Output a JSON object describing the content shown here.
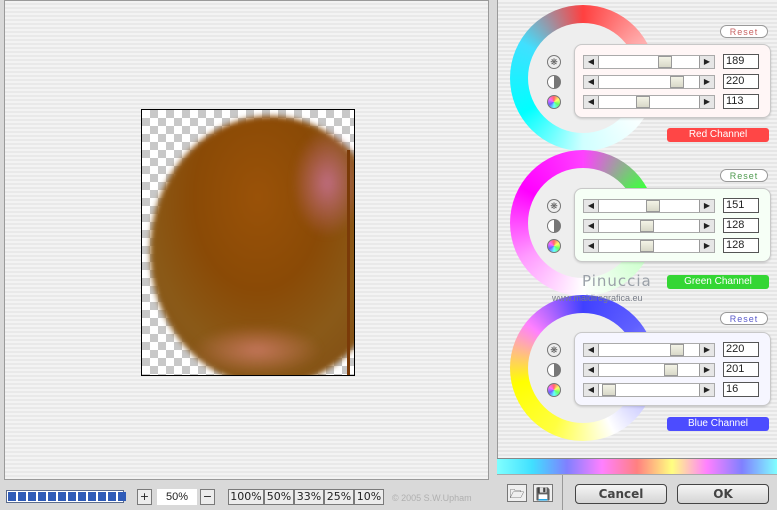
{
  "preview": {
    "zoom_value": "50%",
    "progress": 1.0
  },
  "toolbar": {
    "zoom_in": "+",
    "zoom_out": "−",
    "presets": [
      "100%",
      "50%",
      "33%",
      "25%",
      "10%"
    ],
    "copyright": "© 2005  S.W.Upham"
  },
  "channels": {
    "red": {
      "label": "Red Channel",
      "reset": "Reset",
      "values": [
        "189",
        "220",
        "113"
      ],
      "color": "#ff4646"
    },
    "green": {
      "label": "Green Channel",
      "reset": "Reset",
      "values": [
        "151",
        "128",
        "128"
      ],
      "color": "#34d634"
    },
    "blue": {
      "label": "Blue Channel",
      "reset": "Reset",
      "values": [
        "220",
        "201",
        "16"
      ],
      "color": "#4c4cff"
    }
  },
  "watermark": {
    "name": "Pinuccia",
    "url": "www.maidiregrafica.eu"
  },
  "footer": {
    "cancel": "Cancel",
    "ok": "OK",
    "open_icon": "folder-icon",
    "save_icon": "floppy-icon"
  },
  "icons": {
    "row1": "settings-icon",
    "row2": "contrast-icon",
    "row3": "color-wheel-icon"
  }
}
